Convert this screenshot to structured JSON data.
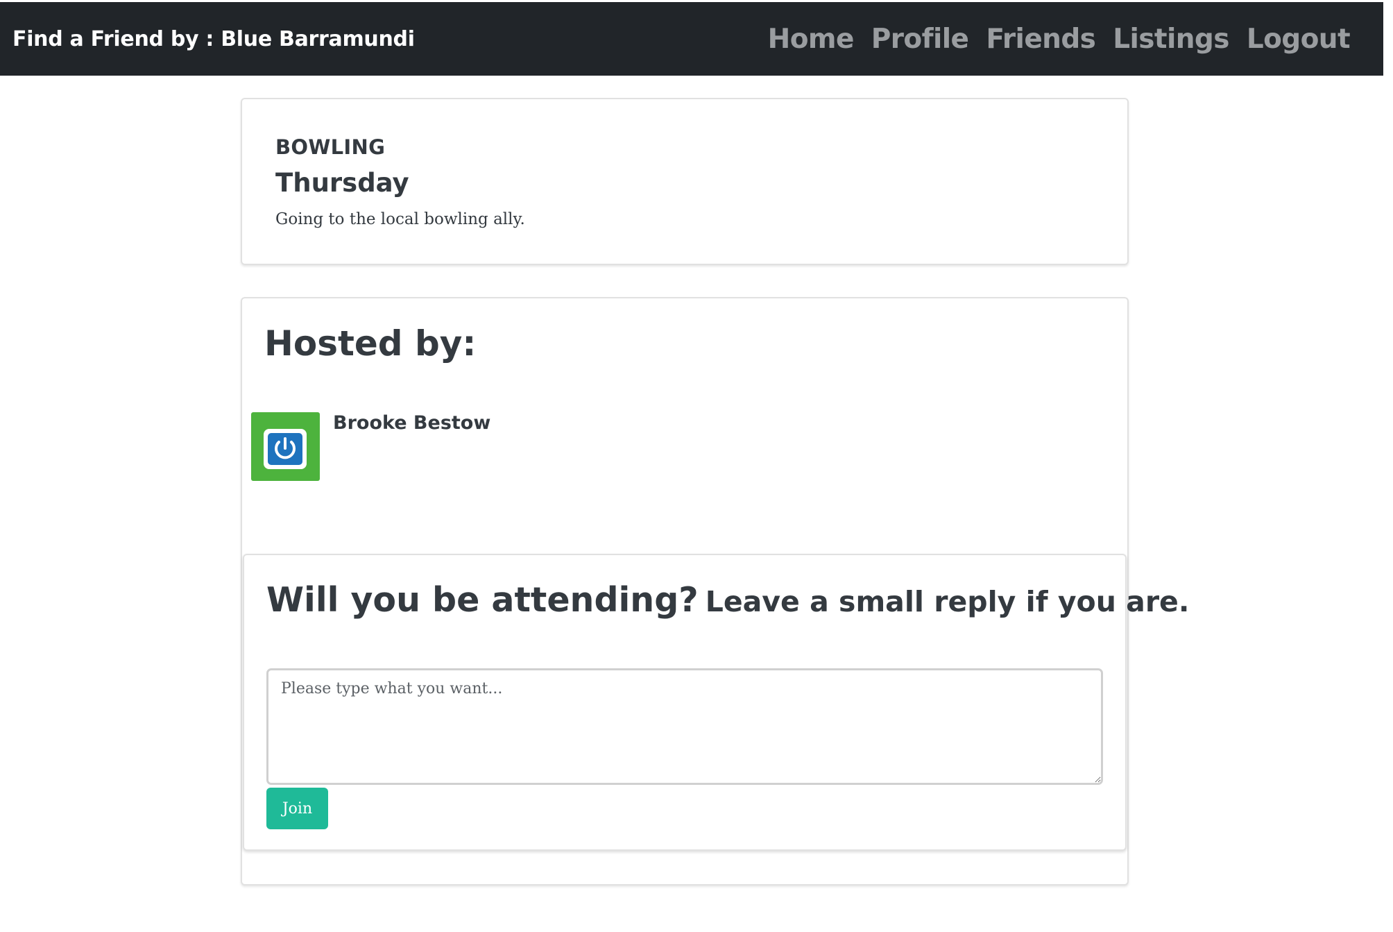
{
  "navbar": {
    "brand": "Find a Friend by : Blue Barramundi",
    "links": [
      "Home",
      "Profile",
      "Friends",
      "Listings",
      "Logout"
    ]
  },
  "event": {
    "category": "BOWLING",
    "day": "Thursday",
    "description": "Going to the local bowling ally."
  },
  "host": {
    "title": "Hosted by:",
    "name": "Brooke Bestow",
    "avatar_icon": "power-button-icon"
  },
  "reply": {
    "question": "Will you be attending?",
    "prompt": "Leave a small reply if you are.",
    "placeholder": "Please type what you want...",
    "value": "",
    "button_label": "Join"
  },
  "colors": {
    "navbar_bg": "#212529",
    "nav_link": "#9a9da0",
    "join_button": "#1fba98",
    "avatar_bg": "#4db33d",
    "avatar_button": "#1e73be"
  }
}
